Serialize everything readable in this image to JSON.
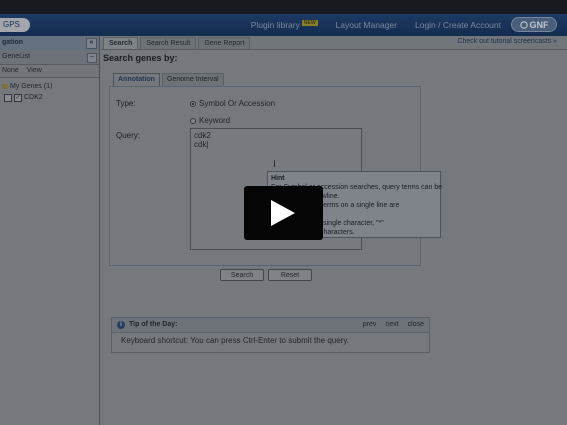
{
  "header": {
    "logo_text": "GPS",
    "links": [
      "Plugin library",
      "Layout Manager",
      "Login / Create Account"
    ],
    "new_badge": "NEW",
    "brand": "GNF"
  },
  "left": {
    "title": "gation",
    "collapse_glyph": "«",
    "sublist": "GeneList",
    "sub_minus": "−",
    "tools": [
      "None",
      "View"
    ],
    "tree": {
      "root": "My Genes (1)",
      "child": "CDK2"
    }
  },
  "tabs": {
    "items": [
      "Search",
      "Search Result",
      "Gene Report"
    ],
    "tutorial": "Check out tutorial screencasts »"
  },
  "search": {
    "title": "Search genes by:",
    "subtabs": [
      "Annotation",
      "Genome Interval"
    ],
    "type_label": "Type:",
    "opt_symbol": "Symbol Or Accession",
    "opt_keyword": "Keyword",
    "query_label": "Query:",
    "query_value": "cdk2\ncdk|",
    "hint_title": "Hint",
    "hint_body": "For Symbol or accession searches, query terms can be\n        ace or a newline.\n        hes, query terms on a single line are\n        rase.\n        titutes for a single character, \"*\"\n        number of characters.",
    "search_btn": "Search",
    "reset_btn": "Reset"
  },
  "tip": {
    "title": "Tip of the Day:",
    "nav": [
      "prev",
      "next",
      "close"
    ],
    "text": "Keyboard shortcut: You can press Ctrl-Enter to submit the query."
  }
}
